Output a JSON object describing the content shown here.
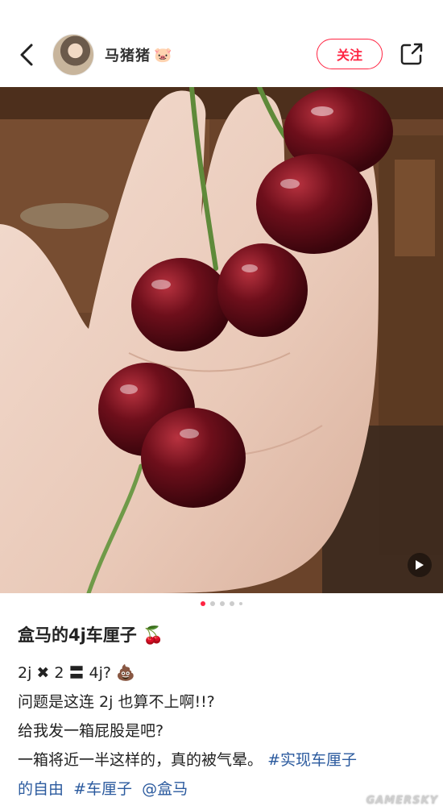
{
  "header": {
    "username": "马猪猪",
    "username_emoji": "🐷",
    "follow_label": "关注"
  },
  "post": {
    "title": "盒马的4j车厘子",
    "title_emoji": "🍒",
    "lines": [
      "2j ✖ 2 〓 4j?",
      "问题是这连 2j 也算不上啊!!?",
      "给我发一箱屁股是吧?",
      "一箱将近一半这样的，真的被气晕。"
    ],
    "line1_emoji": "💩",
    "tags_line4": "#实现车厘子",
    "line5_text": "的自由",
    "tag_1": "#车厘子",
    "mention": "@盒马"
  },
  "carousel": {
    "count": 5,
    "active_index": 0
  },
  "watermark": "GAMERSKY",
  "colors": {
    "accent": "#ff2442",
    "tag": "#2b5a9e"
  },
  "icons": {
    "back": "chevron-left-icon",
    "share": "share-icon",
    "follow": "follow-button",
    "cherry": "cherry-icon"
  }
}
